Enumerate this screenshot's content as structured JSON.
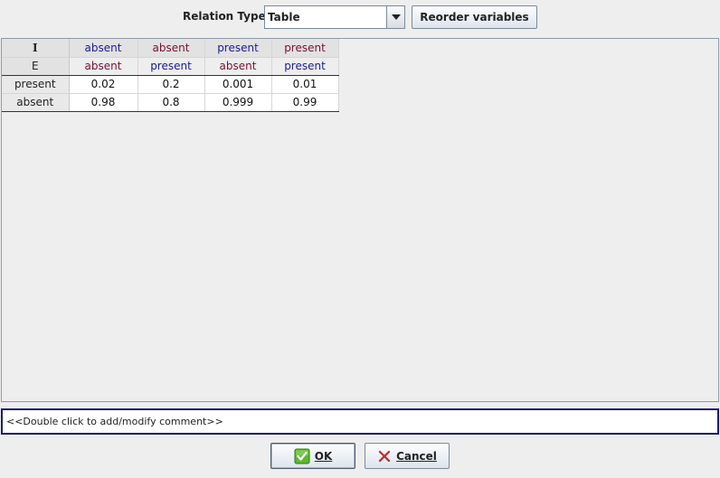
{
  "toolbar": {
    "relation_type_label": "Relation Type:",
    "relation_type_value": "Table",
    "reorder_label": "Reorder variables"
  },
  "table": {
    "header_rows": [
      {
        "variable": "I",
        "values": [
          "absent",
          "absent",
          "present",
          "present"
        ]
      },
      {
        "variable": "E",
        "values": [
          "absent",
          "present",
          "absent",
          "present"
        ]
      }
    ],
    "rows": [
      {
        "state": "present",
        "values": [
          "0.02",
          "0.2",
          "0.001",
          "0.01"
        ]
      },
      {
        "state": "absent",
        "values": [
          "0.98",
          "0.8",
          "0.999",
          "0.99"
        ]
      }
    ]
  },
  "comment": {
    "text": "<<Double click to add/modify comment>>"
  },
  "buttons": {
    "ok_label": "OK",
    "cancel_label": "Cancel",
    "ok_icon": "check-icon",
    "cancel_icon": "x-icon"
  },
  "colors": {
    "blue_text": "#1a1a9c",
    "maroon_text": "#7a1030",
    "comment_border": "#1c1c6e"
  }
}
